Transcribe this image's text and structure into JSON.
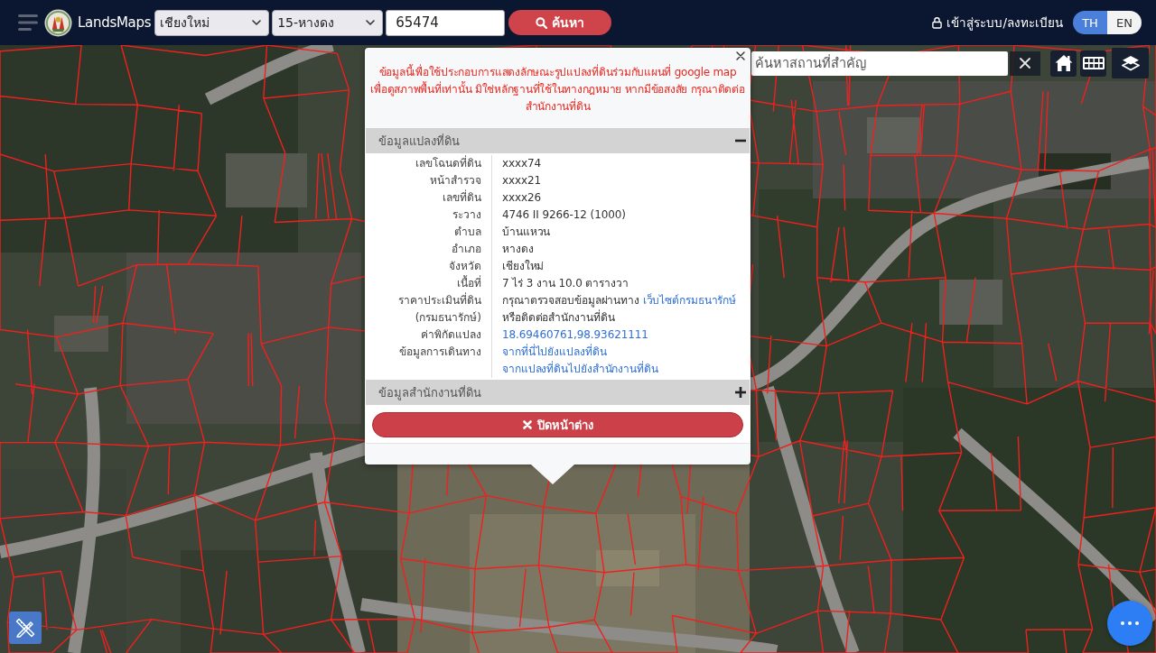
{
  "header": {
    "brand": "LandsMaps",
    "province_select": {
      "value": "เชียงใหม่"
    },
    "district_select": {
      "value": "15-หางดง"
    },
    "parcel_field": {
      "value": "65474"
    },
    "search_button": {
      "label": "ค้นหา"
    },
    "login_link": {
      "label": "เข้าสู่ระบบ/ลงทะเบียน"
    },
    "languages": [
      {
        "label": "TH",
        "selected": true
      },
      {
        "label": "EN",
        "selected": false
      }
    ]
  },
  "map_tools": {
    "place_search": {
      "placeholder": "ค้นหาสถานที่สำคัญ"
    }
  },
  "popup": {
    "notice": "ข้อมูลนี้เพื่อใช้ประกอบการแสดงลักษณะรูปแปลงที่ดินร่วมกับแผนที่ google map เพื่อดูสภาพพื้นที่เท่านั้น มิใช่หลักฐานที่ใช้ในทางกฎหมาย หากมีข้อสงสัย กรุณาติดต่อสำนักงานที่ดิน",
    "sections": [
      {
        "title": "ข้อมูลแปลงที่ดิน",
        "expanded": true,
        "rows": [
          {
            "label": "เลขโฉนดที่ดิน",
            "paragraphs": [
              {
                "parts": [
                  {
                    "kind": "text",
                    "text": "xxxx74"
                  }
                ]
              }
            ]
          },
          {
            "label": "หน้าสำรวจ",
            "paragraphs": [
              {
                "parts": [
                  {
                    "kind": "text",
                    "text": "xxxx21"
                  }
                ]
              }
            ]
          },
          {
            "label": "เลขที่ดิน",
            "paragraphs": [
              {
                "parts": [
                  {
                    "kind": "text",
                    "text": "xxxx26"
                  }
                ]
              }
            ]
          },
          {
            "label": "ระวาง",
            "paragraphs": [
              {
                "parts": [
                  {
                    "kind": "text",
                    "text": "4746 II 9266-12 (1000)"
                  }
                ]
              }
            ]
          },
          {
            "label": "ตำบล",
            "paragraphs": [
              {
                "parts": [
                  {
                    "kind": "text",
                    "text": "บ้านแหวน"
                  }
                ]
              }
            ]
          },
          {
            "label": "อำเภอ",
            "paragraphs": [
              {
                "parts": [
                  {
                    "kind": "text",
                    "text": "หางดง"
                  }
                ]
              }
            ]
          },
          {
            "label": "จังหวัด",
            "paragraphs": [
              {
                "parts": [
                  {
                    "kind": "text",
                    "text": "เชียงใหม่"
                  }
                ]
              }
            ]
          },
          {
            "label": "เนื้อที่",
            "paragraphs": [
              {
                "parts": [
                  {
                    "kind": "text",
                    "text": "7 ไร่ 3 งาน 10.0 ตารางวา"
                  }
                ]
              }
            ]
          },
          {
            "label": "ราคาประเมินที่ดิน (กรมธนารักษ์)",
            "paragraphs": [
              {
                "parts": [
                  {
                    "kind": "text",
                    "text": "กรุณาตรวจสอบข้อมูลผ่านทาง "
                  },
                  {
                    "kind": "link",
                    "text": "เว็บไซต์กรมธนารักษ์"
                  },
                  {
                    "kind": "text",
                    "text": " หรือติดต่อสำนักงานที่ดิน"
                  }
                ]
              }
            ]
          },
          {
            "label": "ค่าพิกัดแปลง",
            "paragraphs": [
              {
                "parts": [
                  {
                    "kind": "link",
                    "text": "18.69460761,98.93621111"
                  }
                ]
              }
            ]
          },
          {
            "label": "ข้อมูลการเดินทาง",
            "paragraphs": [
              {
                "parts": [
                  {
                    "kind": "link",
                    "text": "จากที่นี่ไปยังแปลงที่ดิน"
                  }
                ]
              },
              {
                "parts": [
                  {
                    "kind": "link",
                    "text": "จากแปลงที่ดินไปยังสำนักงานที่ดิน"
                  }
                ]
              }
            ]
          }
        ]
      },
      {
        "title": "ข้อมูลสำนักงานที่ดิน",
        "expanded": false
      }
    ],
    "close_button": {
      "label": "ปิดหน้าต่าง"
    }
  }
}
